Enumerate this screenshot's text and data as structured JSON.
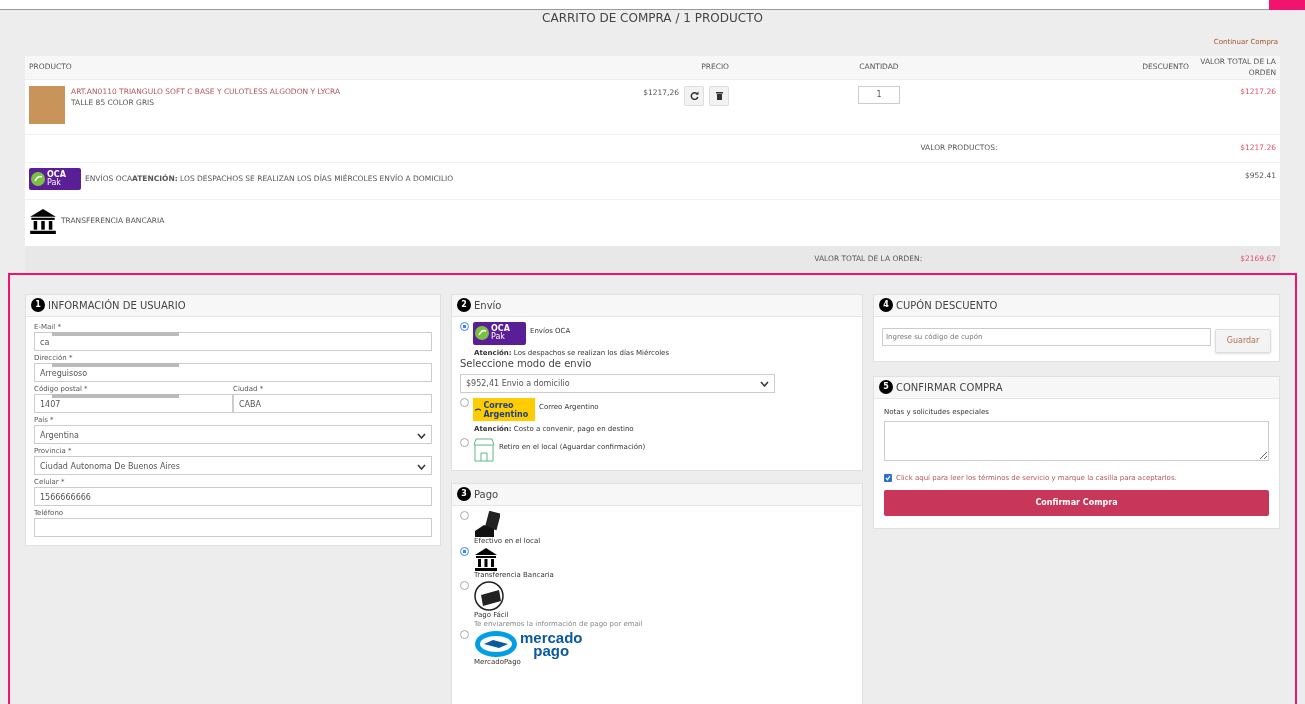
{
  "header": {
    "title": "CARRITO DE COMPRA / 1 PRODUCTO",
    "continue_link": "Continuar Compra"
  },
  "cart": {
    "columns": [
      "PRODUCTO",
      "PRECIO",
      "CANTIDAD",
      "DESCUENTO",
      "VALOR TOTAL DE LA ORDEN"
    ],
    "items": [
      {
        "name": "ART.AN0110 TRIANGULO SOFT C BASE Y CULOTLESS ALGODON Y LYCRA",
        "variant": "TALLE 85 COLOR GRIS",
        "price": "$1217,26",
        "quantity": "1",
        "total": "$1217.26"
      }
    ],
    "subtotal_label": "VALOR PRODUCTOS:",
    "subtotal": "$1217.26",
    "shipping": {
      "logo_text": "OCA",
      "logo_sub": "Pak",
      "text": "ENVÍOS OCA**ATENCIÓN:** LOS DESPACHOS SE REALIZAN LOS DÍAS MIÉRCOLES  ENVÍO A DOMICILIO",
      "amount": "$952.41"
    },
    "payment": {
      "text": "TRANSFERENCIA BANCARIA"
    },
    "total_label": "VALOR TOTAL DE LA ORDEN:",
    "total": "$2169.67"
  },
  "user_info": {
    "step": "1",
    "title": "INFORMACIÓN DE USUARIO",
    "rows": [
      [
        {
          "kind": "text",
          "label": "E-Mail *",
          "value": "ca",
          "redacted": true
        }
      ],
      [
        {
          "kind": "text",
          "label": "Dirección *",
          "value": "Arreguisoso",
          "redacted": true
        }
      ],
      [
        {
          "kind": "text",
          "label": "Código postal *",
          "value": "1407",
          "redacted": true
        },
        {
          "kind": "text",
          "label": "Ciudad *",
          "value": "CABA"
        }
      ],
      [
        {
          "kind": "select",
          "label": "País *",
          "value": "Argentina"
        }
      ],
      [
        {
          "kind": "select",
          "label": "Provincia *",
          "value": "Ciudad Autonoma De Buenos Aires"
        }
      ],
      [
        {
          "kind": "text",
          "label": "Celular *",
          "value": "1566666666"
        }
      ],
      [
        {
          "kind": "text",
          "label": "Teléfono"
        }
      ]
    ]
  },
  "shipping_panel": {
    "step": "2",
    "title": "Envío",
    "options": [
      {
        "kind": "oca",
        "logo_text": "OCA",
        "logo_sub": "Pak",
        "label": "Envíos OCA",
        "selected": true,
        "note": "**Atención:** Los despachos se realizan los días Miércoles",
        "select_label": "Seleccione modo de envio",
        "select_value": "$952,41 Envio a domicilio"
      },
      {
        "kind": "correo",
        "logo_text": "Correo Argentino",
        "label": "Correo Argentino",
        "selected": false,
        "note": "**Atención:** Costo a convenir, pago en destino"
      },
      {
        "kind": "store",
        "label": "Retiro en el local (Aguardar confirmación)",
        "selected": false
      }
    ]
  },
  "payment_panel": {
    "step": "3",
    "title": "Pago",
    "options": [
      {
        "kind": "cash",
        "label": "Efectivo en el local",
        "selected": false
      },
      {
        "kind": "bank",
        "label": "Transferencia Bancaria",
        "selected": true
      },
      {
        "kind": "pagofacil",
        "label": "Pago Fácil",
        "note": "Te enviaremos la información de pago por email",
        "selected": false
      },
      {
        "kind": "mercadopago",
        "logo_text": "mercado",
        "logo_sub": "pago",
        "label": "MercadoPago",
        "selected": false
      }
    ]
  },
  "coupon": {
    "step": "4",
    "title": "CUPÓN DESCUENTO",
    "placeholder": "Ingrese su código de cupón",
    "button": "Guardar"
  },
  "confirm": {
    "step": "5",
    "title": "CONFIRMAR COMPRA",
    "notes_label": "Notas y solicitudes especiales",
    "terms": {
      "text": "Click aquí para leer los términos de servicio y marque la casilla para aceptarlos.",
      "checked": true
    },
    "button": "Confirmar Compra"
  }
}
